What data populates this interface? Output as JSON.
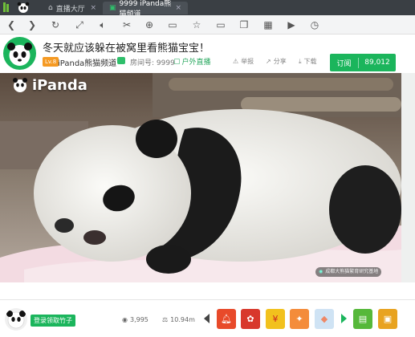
{
  "tabs": {
    "home_label": "直播大厅",
    "live_label": "9999 iPanda熊猫频道"
  },
  "toolbar": {
    "icons": [
      "back-icon",
      "forward-icon",
      "refresh-icon",
      "fullscreen-icon",
      "volume-icon",
      "cut-icon",
      "zoom-icon",
      "camera-icon",
      "star-icon",
      "screen-icon",
      "window-icon",
      "qr-icon",
      "record-icon",
      "history-icon"
    ]
  },
  "header": {
    "title": "冬天就应该躲在被窝里看熊猫宝宝！",
    "level": "Lv.8",
    "channel_name": "iPanda熊猫频道",
    "room_no": "房间号: 9999",
    "outdoor_tag": "户外直播",
    "report_label": "举报",
    "share_label": "分享",
    "download_label": "下载",
    "subscribe_label": "订阅",
    "subscribe_count": "89,012"
  },
  "video": {
    "watermark": "iPanda",
    "credit": "成都大熊猫繁育研究基地"
  },
  "bottom": {
    "bamboo_button": "登录领取竹子",
    "viewers": "3,995",
    "weight": "10.94m"
  },
  "colors": {
    "brand_green": "#1bb55c",
    "titlebar": "#3a3f44",
    "level_orange": "#f59a23"
  }
}
